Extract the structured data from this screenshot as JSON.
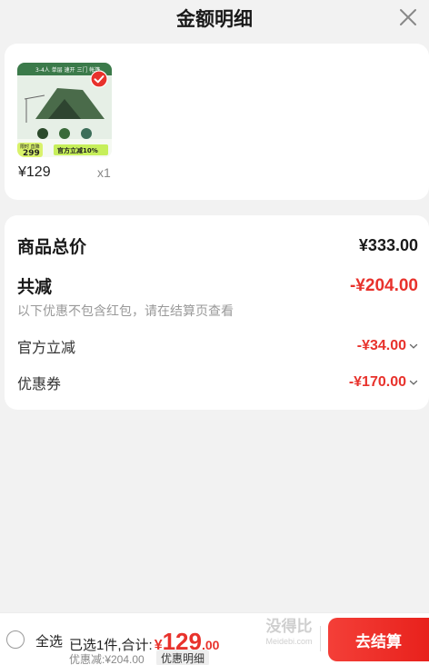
{
  "header": {
    "title": "金额明细"
  },
  "product": {
    "image_banner": "3-4人 单层 速开 三门 帐篷",
    "image_price": "299",
    "image_tag_left": "限时 直降",
    "image_tag": "官方立减10%",
    "price": "¥129",
    "quantity": "x1"
  },
  "summary": {
    "total_label": "商品总价",
    "total_value": "¥333.00",
    "reduce_label": "共减",
    "reduce_value": "-¥204.00",
    "note": "以下优惠不包含红包，请在结算页查看",
    "official_label": "官方立减",
    "official_value": "-¥34.00",
    "coupon_label": "优惠券",
    "coupon_value": "-¥170.00"
  },
  "bottom": {
    "select_all": "全选",
    "selected_prefix": "已选1件,合计:",
    "total_symbol": "¥",
    "total_int": "129",
    "total_dec": ".00",
    "discount_text": "优惠减:¥204.00",
    "detail_button": "优惠明细",
    "checkout_button": "去结算",
    "watermark": "没得比",
    "watermark_sub": "Meidebi.com"
  },
  "colors": {
    "accent": "#e8322c",
    "background": "#f2f2f2",
    "card": "#ffffff"
  }
}
